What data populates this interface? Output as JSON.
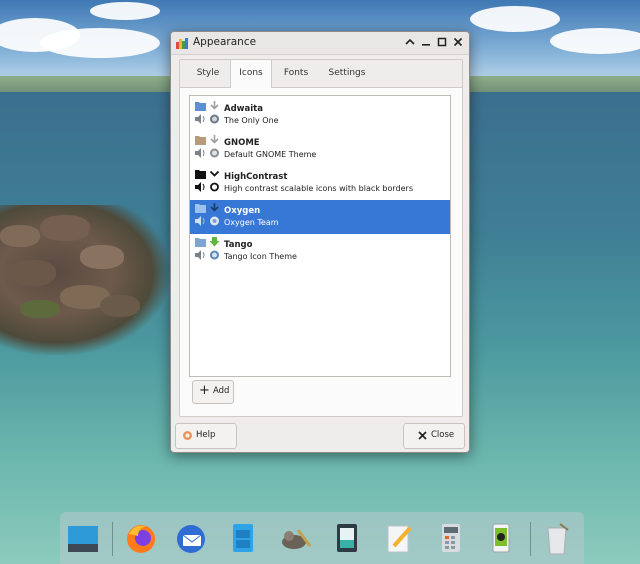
{
  "window": {
    "title": "Appearance",
    "controls": {
      "minimize": "⌃",
      "maximize": "☐",
      "restore": "□",
      "close": "✕"
    }
  },
  "tabs": [
    {
      "label": "Style",
      "active": false
    },
    {
      "label": "Icons",
      "active": true
    },
    {
      "label": "Fonts",
      "active": false
    },
    {
      "label": "Settings",
      "active": false
    }
  ],
  "themes": [
    {
      "name": "Adwaita",
      "description": "The Only One",
      "selected": false
    },
    {
      "name": "GNOME",
      "description": "Default GNOME Theme",
      "selected": false
    },
    {
      "name": "HighContrast",
      "description": "High contrast scalable icons with black borders",
      "selected": false
    },
    {
      "name": "Oxygen",
      "description": "Oxygen Team",
      "selected": true
    },
    {
      "name": "Tango",
      "description": "Tango Icon Theme",
      "selected": false
    }
  ],
  "buttons": {
    "add": "Add",
    "help": "Help",
    "close": "Close"
  },
  "dock": {
    "items": [
      "desktop-icon",
      "firefox-icon",
      "thunderbird-icon",
      "file-manager-icon",
      "gimp-icon",
      "image-viewer-icon",
      "text-editor-icon",
      "calculator-icon",
      "phone-icon",
      "trash-icon"
    ]
  },
  "colors": {
    "selection": "#3778d6",
    "window_bg": "#efedec"
  }
}
